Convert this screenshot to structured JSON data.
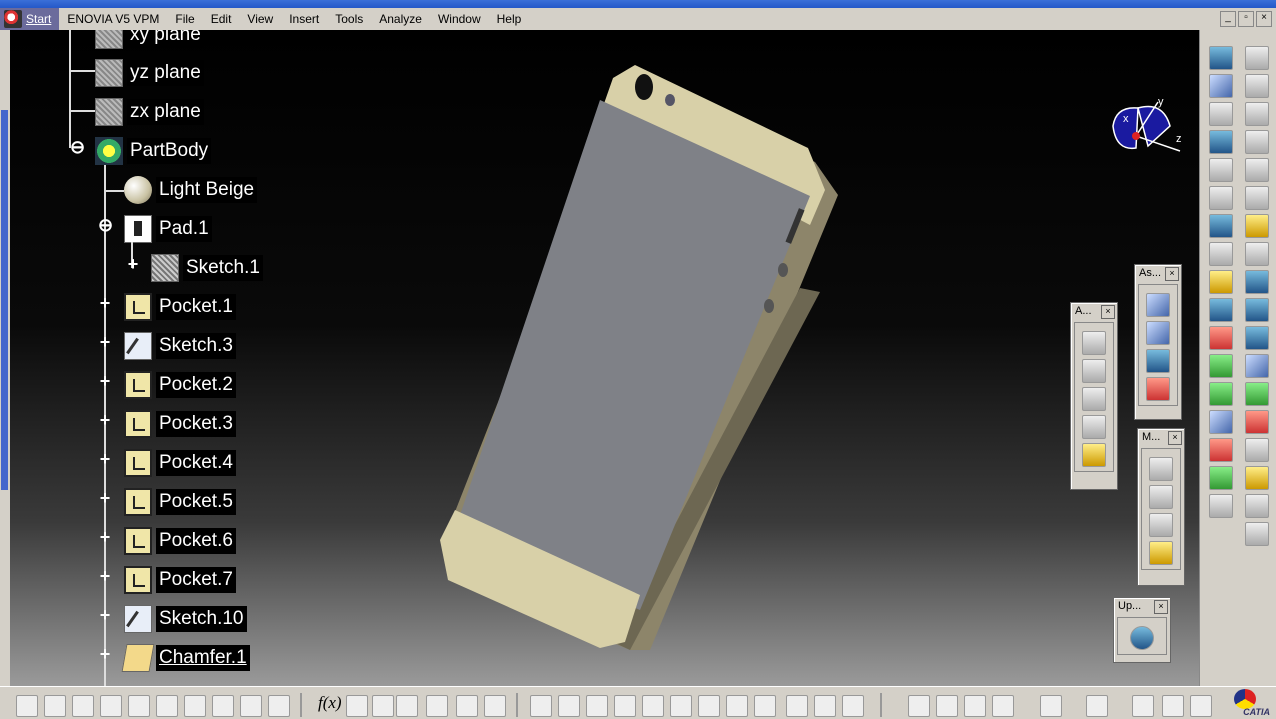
{
  "menu": {
    "start": "Start",
    "items": [
      "ENOVIA V5 VPM",
      "File",
      "Edit",
      "View",
      "Insert",
      "Tools",
      "Analyze",
      "Window",
      "Help"
    ]
  },
  "window_controls": [
    "_",
    "▫",
    "×"
  ],
  "tree": {
    "nodes": [
      {
        "label": "xy plane",
        "icon": "plane-icon"
      },
      {
        "label": "yz plane",
        "icon": "plane-icon"
      },
      {
        "label": "zx plane",
        "icon": "plane-icon"
      },
      {
        "label": "PartBody",
        "icon": "partbody-icon"
      },
      {
        "label": "Light Beige",
        "icon": "material-icon"
      },
      {
        "label": "Pad.1",
        "icon": "pad-icon"
      },
      {
        "label": "Sketch.1",
        "icon": "sketch-icon"
      },
      {
        "label": "Pocket.1",
        "icon": "pocket-icon"
      },
      {
        "label": "Sketch.3",
        "icon": "sketch-icon"
      },
      {
        "label": "Pocket.2",
        "icon": "pocket-icon"
      },
      {
        "label": "Pocket.3",
        "icon": "pocket-icon"
      },
      {
        "label": "Pocket.4",
        "icon": "pocket-icon"
      },
      {
        "label": "Pocket.5",
        "icon": "pocket-icon"
      },
      {
        "label": "Pocket.6",
        "icon": "pocket-icon"
      },
      {
        "label": "Pocket.7",
        "icon": "pocket-icon"
      },
      {
        "label": "Sketch.10",
        "icon": "sketch-icon"
      },
      {
        "label": "Chamfer.1",
        "icon": "chamfer-icon"
      }
    ]
  },
  "compass": {
    "x": "x",
    "y": "y",
    "z": "z"
  },
  "floating_toolbars": {
    "annotations": {
      "title": "A..."
    },
    "assembly": {
      "title": "As..."
    },
    "measure": {
      "title": "M..."
    },
    "update": {
      "title": "Up..."
    }
  },
  "bottom_toolbar": {
    "formula_label": "f(x)"
  },
  "brand": {
    "name": "CATIA"
  },
  "colors": {
    "phone_face": "#7f8187",
    "phone_beige": "#d8d0a8",
    "phone_frame": "#8d856a",
    "menu_bg": "#d4d0c8"
  }
}
